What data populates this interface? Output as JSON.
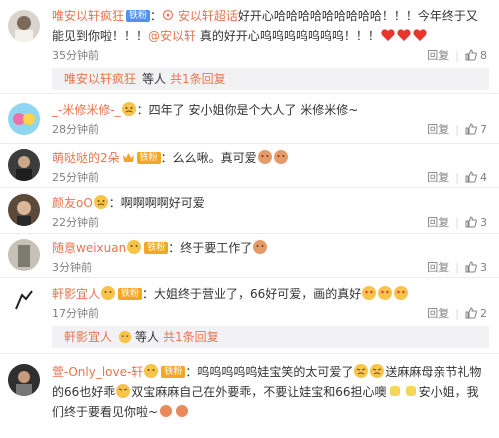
{
  "comments": [
    {
      "username": "唯安以轩疯狂",
      "badge": "铁粉",
      "text_parts": [
        "：",
        "安以轩超话",
        "好开心哈哈哈哈哈哈哈哈哈！！！今年终于又能见到你啦！！！",
        "@安以轩",
        " 真的好开心呜呜呜呜呜呜呜！！！"
      ],
      "time": "35分钟前",
      "reply": "回复",
      "likes": "8",
      "reply_summary": {
        "user": "唯安以轩疯狂",
        "rest": "等人",
        "count": "共1条回复"
      }
    },
    {
      "username": "_-米修米修-_",
      "text": "：四年了 安小姐你是个大人了 米修米修~",
      "time": "28分钟前",
      "reply": "回复",
      "likes": "7"
    },
    {
      "username": "萌哒哒的2朵",
      "badge": "铁粉",
      "text": "：么么啾。真可爱",
      "time": "25分钟前",
      "reply": "回复",
      "likes": "4"
    },
    {
      "username": "颜友oO",
      "text": "：啊啊啊啊好可爱",
      "time": "22分钟前",
      "reply": "回复",
      "likes": "3"
    },
    {
      "username": "随意weixuan",
      "badge": "铁粉",
      "text": "：终于要工作了",
      "time": "3分钟前",
      "reply": "回复",
      "likes": "3"
    },
    {
      "username": "軒影宜人",
      "badge": "铁粉",
      "text": "：大姐终于营业了，66好可爱，画的真好",
      "time": "17分钟前",
      "reply": "回复",
      "likes": "2",
      "reply_summary": {
        "user": "軒影宜人",
        "rest": "等人",
        "count": "共1条回复"
      }
    },
    {
      "username": "萱-Only_love-轩",
      "badge": "铁粉",
      "text_a": "：呜呜呜呜呜娃宝笑的太可爱了",
      "text_b": "送麻麻母亲节礼物的66也好乖",
      "text_c": "双宝麻麻自己在外要乖，不要让娃宝和66担心噢",
      "text_d": "安小姐，我们终于要看见你啦~",
      "time": "",
      "reply": "",
      "likes": ""
    }
  ],
  "colors": {
    "link": "#eb7350",
    "muted": "#808080",
    "divider": "#ececec",
    "reply_bg": "#f2f2f5"
  },
  "icons": [
    "vip-crown-icon",
    "like-thumb-icon",
    "emoji-cry-icon",
    "emoji-heart-icon",
    "emoji-hand-icon"
  ]
}
